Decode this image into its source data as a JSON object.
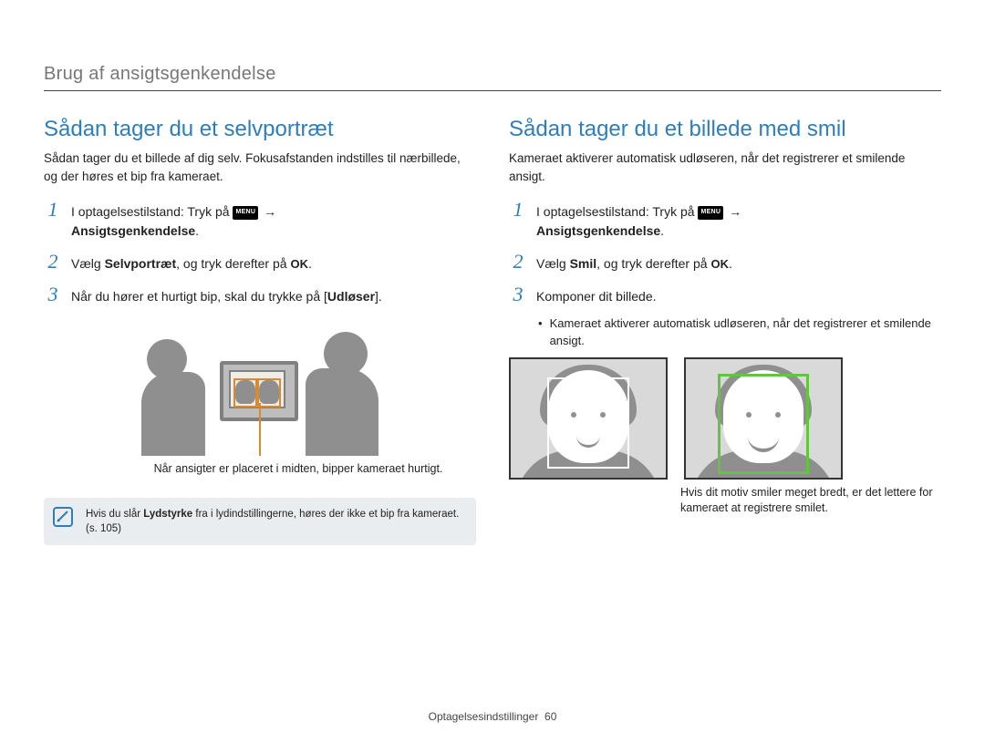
{
  "header": "Brug af ansigtsgenkendelse",
  "footer": {
    "section": "Optagelsesindstillinger",
    "page": "60"
  },
  "icons": {
    "menu": "MENU",
    "ok": "OK",
    "arrow": "→"
  },
  "left": {
    "title": "Sådan tager du et selvportræt",
    "intro": "Sådan tager du et billede af dig selv. Fokusafstanden indstilles til nærbillede, og der høres et bip fra kameraet.",
    "steps": [
      {
        "num": "1",
        "pre": "I optagelsestilstand: Tryk på ",
        "post": "Ansigtsgenkendelse",
        "postSuffix": "."
      },
      {
        "num": "2",
        "pre": "Vælg ",
        "bold": "Selvportræt",
        "mid": ", og tryk derefter på ",
        "suffix": "."
      },
      {
        "num": "3",
        "pre": "Når du hører et hurtigt bip, skal du trykke på [",
        "bold": "Udløser",
        "suffix": "]."
      }
    ],
    "caption": "Når ansigter er placeret i midten, bipper kameraet hurtigt.",
    "note": {
      "pre": "Hvis du slår ",
      "bold": "Lydstyrke",
      "post": " fra i lydindstillingerne, høres der ikke et bip fra kameraet. (s. 105)"
    }
  },
  "right": {
    "title": "Sådan tager du et billede med smil",
    "intro": "Kameraet aktiverer automatisk udløseren, når det registrerer et smilende ansigt.",
    "steps": [
      {
        "num": "1",
        "pre": "I optagelsestilstand: Tryk på ",
        "post": "Ansigtsgenkendelse",
        "postSuffix": "."
      },
      {
        "num": "2",
        "pre": "Vælg ",
        "bold": "Smil",
        "mid": ", og tryk derefter på ",
        "suffix": "."
      },
      {
        "num": "3",
        "text": "Komponer dit billede."
      }
    ],
    "bullet": "Kameraet aktiverer automatisk udløseren, når det registrerer et smilende ansigt.",
    "caption": "Hvis dit motiv smiler meget bredt, er det lettere for kameraet at registrere smilet."
  }
}
